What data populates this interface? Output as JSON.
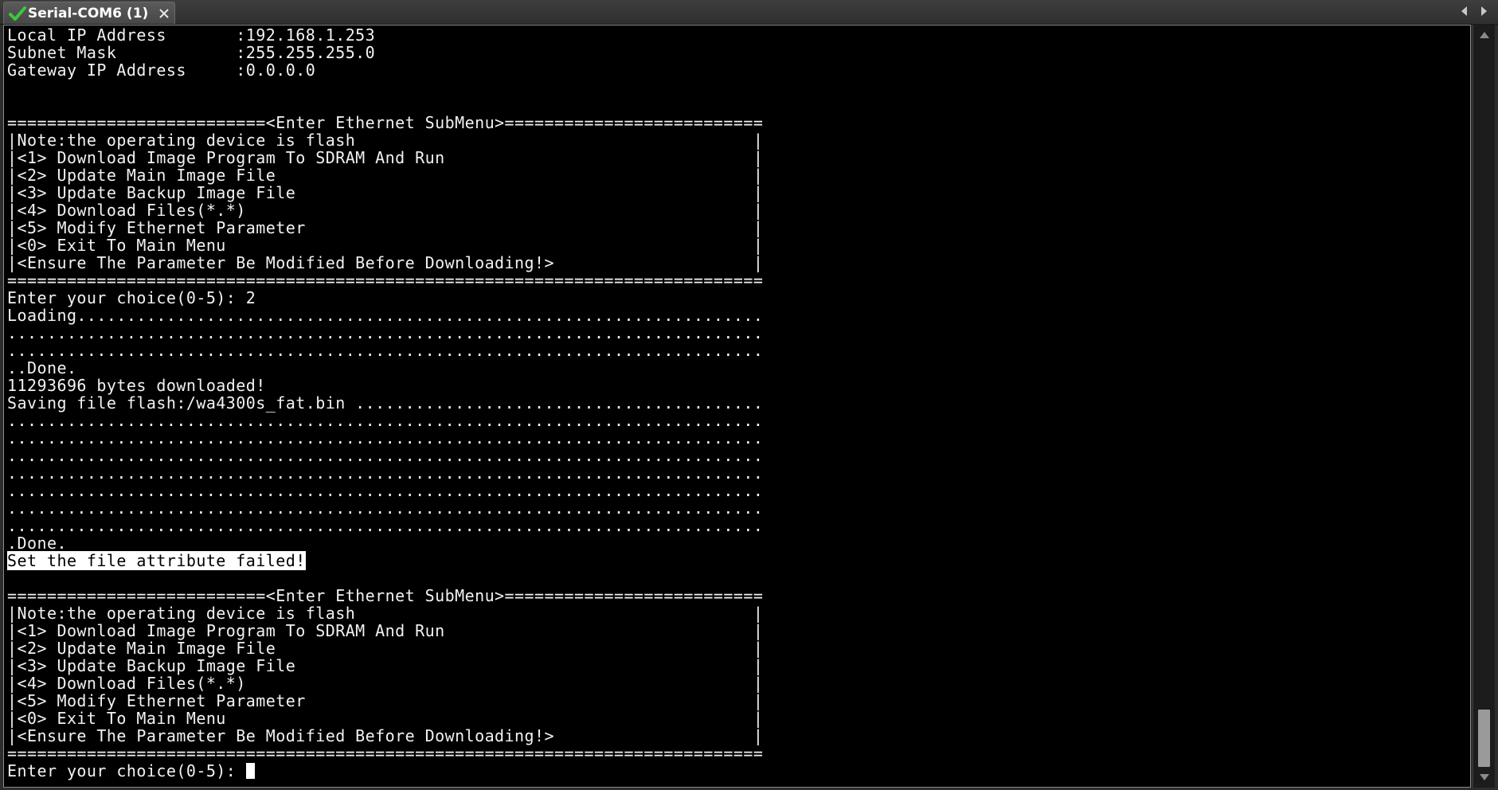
{
  "window": {
    "tab_title": "Serial-COM6 (1)"
  },
  "icons": {
    "status": "check-icon",
    "close": "close-icon",
    "nav_prev": "chevron-left-icon",
    "nav_next": "chevron-right-icon",
    "scroll_up": "scroll-up-icon",
    "scroll_down": "scroll-down-icon"
  },
  "colors": {
    "terminal_background": "#000000",
    "terminal_text": "#f2f2f2",
    "check_icon": "#3cc83c"
  },
  "terminal": {
    "lines": [
      "Local IP Address       :192.168.1.253",
      "Subnet Mask            :255.255.255.0",
      "Gateway IP Address     :0.0.0.0",
      "",
      "",
      "==========================<Enter Ethernet SubMenu>==========================",
      "|Note:the operating device is flash                                        |",
      "|<1> Download Image Program To SDRAM And Run                               |",
      "|<2> Update Main Image File                                                |",
      "|<3> Update Backup Image File                                              |",
      "|<4> Download Files(*.*)                                                   |",
      "|<5> Modify Ethernet Parameter                                             |",
      "|<0> Exit To Main Menu                                                     |",
      "|<Ensure The Parameter Be Modified Before Downloading!>                    |",
      "============================================================================",
      "Enter your choice(0-5): 2",
      "Loading.....................................................................",
      "............................................................................",
      "............................................................................",
      "..Done.",
      "11293696 bytes downloaded!",
      "Saving file flash:/wa4300s_fat.bin .........................................",
      "............................................................................",
      "............................................................................",
      "............................................................................",
      "............................................................................",
      "............................................................................",
      "............................................................................",
      "............................................................................",
      ".Done.",
      "",
      "",
      "==========================<Enter Ethernet SubMenu>==========================",
      "|Note:the operating device is flash                                        |",
      "|<1> Download Image Program To SDRAM And Run                               |",
      "|<2> Update Main Image File                                                |",
      "|<3> Update Backup Image File                                              |",
      "|<4> Download Files(*.*)                                                   |",
      "|<5> Modify Ethernet Parameter                                             |",
      "|<0> Exit To Main Menu                                                     |",
      "|<Ensure The Parameter Be Modified Before Downloading!>                    |",
      "============================================================================",
      ""
    ],
    "highlighted_message": "Set the file attribute failed!",
    "prompt": "Enter your choice(0-5): "
  }
}
